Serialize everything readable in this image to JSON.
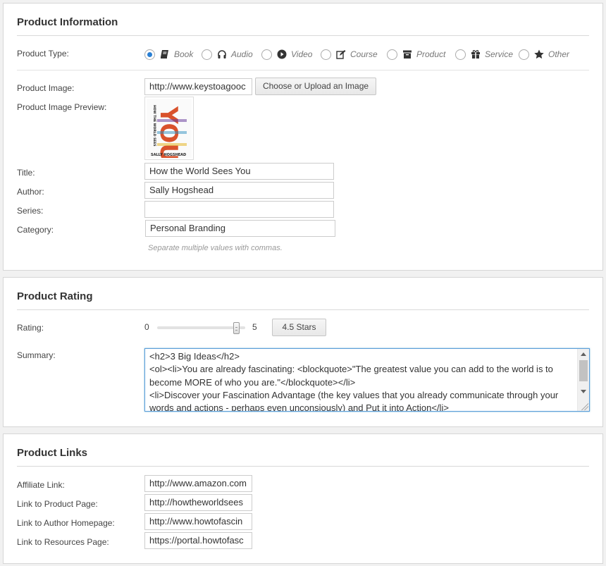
{
  "product_information": {
    "title": "Product Information",
    "product_type": {
      "label": "Product Type:",
      "selected": "Book",
      "options": [
        {
          "label": "Book",
          "icon": "book-icon"
        },
        {
          "label": "Audio",
          "icon": "headphones-icon"
        },
        {
          "label": "Video",
          "icon": "play-circle-icon"
        },
        {
          "label": "Course",
          "icon": "edit-icon"
        },
        {
          "label": "Product",
          "icon": "archive-box-icon"
        },
        {
          "label": "Service",
          "icon": "gift-icon"
        },
        {
          "label": "Other",
          "icon": "star-icon"
        }
      ]
    },
    "product_image": {
      "label": "Product Image:",
      "value": "http://www.keystoagooc",
      "button_label": "Choose or Upload an Image"
    },
    "preview": {
      "label": "Product Image Preview:",
      "cover_big_text": "YOU",
      "cover_side_text": "HOW THE WORLD SEES",
      "cover_author": "SALLY HOGSHEAD"
    },
    "fields": {
      "title_label": "Title:",
      "title_value": "How the World Sees You",
      "author_label": "Author:",
      "author_value": "Sally Hogshead",
      "series_label": "Series:",
      "series_value": "",
      "category_label": "Category:",
      "category_value": "Personal Branding"
    },
    "hint": "Separate multiple values with commas."
  },
  "product_rating": {
    "title": "Product Rating",
    "rating_label": "Rating:",
    "min_label": "0",
    "max_label": "5",
    "rating_value": 4.5,
    "rating_max": 5,
    "stars_button_label": "4.5 Stars",
    "summary_label": "Summary:",
    "summary_text": "<h2>3 Big Ideas</h2>\n<ol><li>You are already fascinating: <blockquote>\"The greatest value you can add to the world is to become MORE of who you are.\"</blockquote></li>\n<li>Discover your Fascination Advantage (the key values that you already communicate through your words and actions - perhaps even unconsiously) and Put it into Action</li>"
  },
  "product_links": {
    "title": "Product Links",
    "affiliate_label": "Affiliate Link:",
    "affiliate_value": "http://www.amazon.com",
    "product_page_label": "Link to Product Page:",
    "product_page_value": "http://howtheworldsees",
    "author_home_label": "Link to Author Homepage:",
    "author_home_value": "http://www.howtofascin",
    "resources_label": "Link to Resources Page:",
    "resources_value": "https://portal.howtofasc"
  },
  "colors": {
    "radio_selected": "#2a7fd3",
    "focus_border": "#5b9dd9",
    "hint_text": "#999999"
  }
}
